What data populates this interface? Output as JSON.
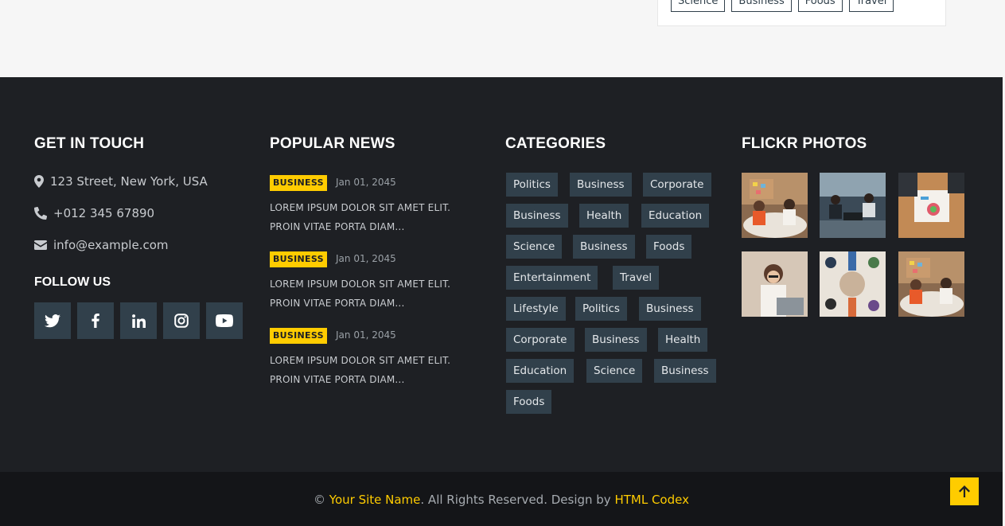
{
  "top_tags": [
    "Science",
    "Business",
    "Foods",
    "Travel"
  ],
  "contact": {
    "title": "GET IN TOUCH",
    "address": "123 Street, New York, USA",
    "phone": "+012 345 67890",
    "email": "info@example.com",
    "follow_title": "FOLLOW US",
    "socials": [
      "twitter-icon",
      "facebook-icon",
      "linkedin-icon",
      "instagram-icon",
      "youtube-icon"
    ]
  },
  "popular_news": {
    "title": "POPULAR NEWS",
    "items": [
      {
        "badge": "BUSINESS",
        "date": "Jan 01, 2045",
        "line1": "LOREM IPSUM DOLOR SIT AMET ELIT.",
        "line2": "PROIN VITAE PORTA DIAM..."
      },
      {
        "badge": "BUSINESS",
        "date": "Jan 01, 2045",
        "line1": "LOREM IPSUM DOLOR SIT AMET ELIT.",
        "line2": "PROIN VITAE PORTA DIAM..."
      },
      {
        "badge": "BUSINESS",
        "date": "Jan 01, 2045",
        "line1": "LOREM IPSUM DOLOR SIT AMET ELIT.",
        "line2": "PROIN VITAE PORTA DIAM..."
      }
    ]
  },
  "categories": {
    "title": "CATEGORIES",
    "rows": [
      [
        "Politics",
        "Business",
        "Corporate"
      ],
      [
        "Business",
        "Health",
        "Education"
      ],
      [
        "Science",
        "Business",
        "Foods"
      ],
      [
        "Entertainment",
        "Travel"
      ],
      [
        "Lifestyle",
        "Politics",
        "Business"
      ],
      [
        "Corporate",
        "Business",
        "Health"
      ],
      [
        "Education",
        "Science",
        "Business"
      ],
      [
        "Foods"
      ]
    ]
  },
  "flickr": {
    "title": "FLICKR PHOTOS"
  },
  "copyright": {
    "prefix": "© ",
    "site_name": "Your Site Name",
    "middle": ". All Rights Reserved. Design by ",
    "designer": "HTML Codex"
  },
  "colors": {
    "accent": "#ffcc00",
    "footer_bg": "#1e2024",
    "tag_bg": "#31404b"
  }
}
